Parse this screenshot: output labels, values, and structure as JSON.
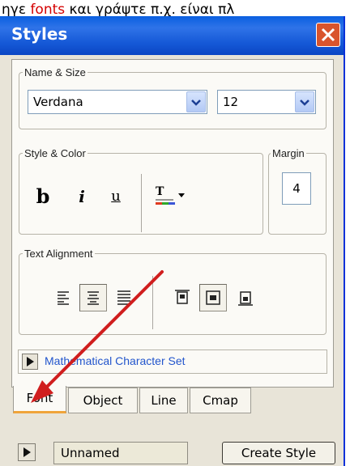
{
  "caption": {
    "prefix": "ηγε ",
    "highlight": "fonts",
    "suffix": " και γράψτε π.χ. είναι πλ"
  },
  "window": {
    "title": "Styles"
  },
  "name_size": {
    "legend": "Name & Size",
    "font": "Verdana",
    "size": "12"
  },
  "style_color": {
    "legend": "Style & Color",
    "bold": "b",
    "italic": "i",
    "underline": "u",
    "text_color_glyph": "T"
  },
  "margin": {
    "legend": "Margin",
    "value": "4"
  },
  "alignment": {
    "legend": "Text Alignment"
  },
  "math": {
    "label": "Mathematical Character Set"
  },
  "tabs": [
    {
      "label": "Font"
    },
    {
      "label": "Object"
    },
    {
      "label": "Line"
    },
    {
      "label": "Cmap"
    }
  ],
  "bottom": {
    "name_value": "Unnamed",
    "create_label": "Create Style"
  },
  "colors": {
    "title_bar": "#1558d6",
    "close": "#d9542c",
    "arrow": "#d01e1e",
    "tab_accent": "#f0a43a",
    "math_link": "#2255cc"
  }
}
